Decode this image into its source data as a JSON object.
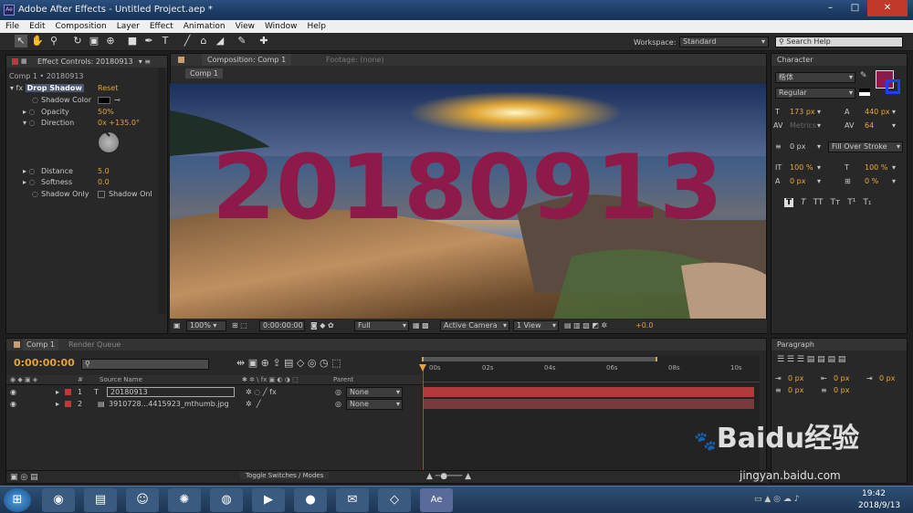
{
  "window": {
    "title": "Adobe After Effects - Untitled Project.aep *"
  },
  "menu": [
    "File",
    "Edit",
    "Composition",
    "Layer",
    "Effect",
    "Animation",
    "View",
    "Window",
    "Help"
  ],
  "toolbar": {
    "workspace_label": "Workspace:",
    "workspace_value": "Standard",
    "search_placeholder": "Search Help"
  },
  "effect_controls": {
    "tab": "Effect Controls: 20180913",
    "breadcrumb": "Comp 1 • 20180913",
    "effect_name": "Drop Shadow",
    "reset": "Reset",
    "props": [
      {
        "name": "Shadow Color",
        "value": ""
      },
      {
        "name": "Opacity",
        "value": "50%"
      },
      {
        "name": "Direction",
        "value": "0x +135.0°"
      },
      {
        "name": "Distance",
        "value": "5.0"
      },
      {
        "name": "Softness",
        "value": "0.0"
      },
      {
        "name": "Shadow Only",
        "value": "Shadow Onl"
      }
    ]
  },
  "composition": {
    "tab": "Composition: Comp 1",
    "footage_tab": "Footage: (none)",
    "subtab": "Comp 1",
    "text": "20180913",
    "text_color": "#8e1a4a",
    "zoom": "100%",
    "timecode": "0:00:00:00",
    "resolution": "Full",
    "camera": "Active Camera",
    "view": "1 View",
    "exposure": "+0.0"
  },
  "character": {
    "tab": "Character",
    "font": "楷体",
    "style": "Regular",
    "font_size": "173 px",
    "leading": "440 px",
    "kerning": "Metrics",
    "tracking": "64",
    "stroke": "0 px",
    "stroke_mode": "Fill Over Stroke",
    "v_scale": "100 %",
    "h_scale": "100 %",
    "baseline": "0 px",
    "tsume": "0 %",
    "fill_color": "#8e1a4a",
    "style_buttons": [
      "T",
      "T",
      "TT",
      "Tт",
      "T¹",
      "T₁"
    ]
  },
  "paragraph": {
    "tab": "Paragraph",
    "values": [
      "0 px",
      "0 px",
      "0 px",
      "0 px",
      "0 px"
    ]
  },
  "timeline": {
    "tab": "Comp 1",
    "render_tab": "Render Queue",
    "timecode": "0:00:00:00",
    "col_source": "Source Name",
    "col_parent": "Parent",
    "ruler": [
      "00s",
      "02s",
      "04s",
      "06s",
      "08s",
      "10s"
    ],
    "layers": [
      {
        "num": "1",
        "name": "20180913",
        "parent": "None",
        "color": "#c0383b"
      },
      {
        "num": "2",
        "name": "3910728...4415923_mthumb.jpg",
        "parent": "None",
        "color": "#c0383b"
      }
    ],
    "toggle": "Toggle Switches / Modes"
  },
  "taskbar": {
    "time": "19:42",
    "date": "2018/9/13"
  },
  "watermark": {
    "brand": "Baidu经验",
    "url": "jingyan.baidu.com"
  }
}
